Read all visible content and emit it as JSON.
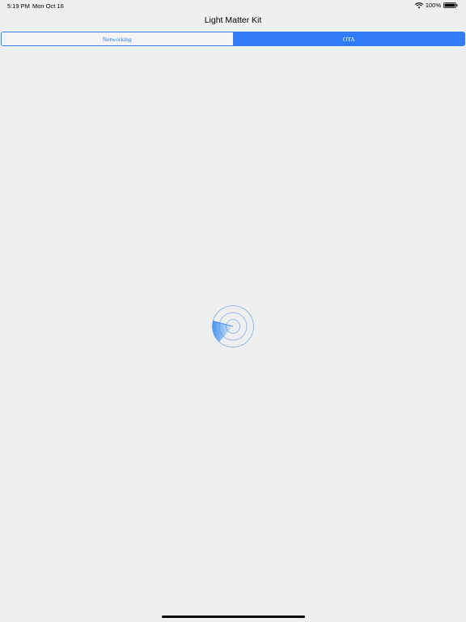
{
  "status_bar": {
    "time": "5:19 PM",
    "date": "Mon Oct 16",
    "battery": "100%",
    "icons": [
      "wifi-icon",
      "battery-icon"
    ]
  },
  "nav": {
    "title": "Light Matter Kit"
  },
  "segments": {
    "networking": "Networking",
    "ota": "OTA",
    "selected": "OTA"
  },
  "colors": {
    "accent": "#2f7cf6",
    "background": "#efefef"
  },
  "loader": {
    "icon": "radar-scanning-icon"
  }
}
